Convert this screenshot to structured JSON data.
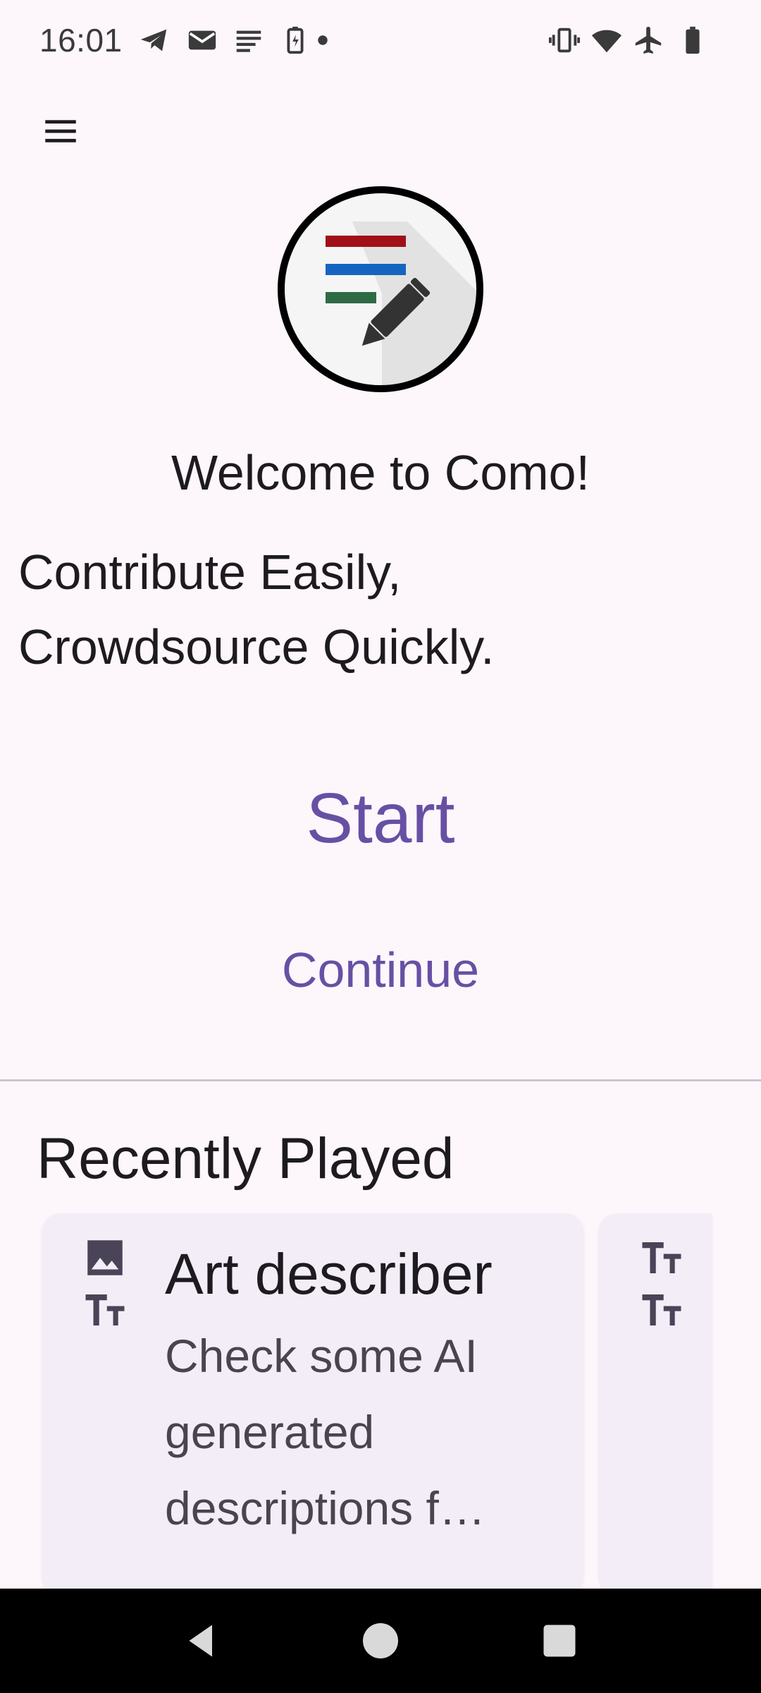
{
  "status_bar": {
    "time": "16:01",
    "left_icons": [
      "telegram-icon",
      "mail-icon",
      "notes-icon",
      "battery-saver-icon",
      "dot-icon"
    ],
    "right_icons": [
      "vibrate-icon",
      "wifi-icon",
      "airplane-mode-icon",
      "battery-icon"
    ]
  },
  "app_bar": {
    "menu_icon": "menu-icon"
  },
  "hero": {
    "logo_icon": "como-logo",
    "welcome": "Welcome to Como!",
    "tagline_line1": "Contribute Easily,",
    "tagline_line2": "Crowdsource Quickly."
  },
  "actions": {
    "start_label": "Start",
    "continue_label": "Continue"
  },
  "recently_played": {
    "title": "Recently Played",
    "cards": [
      {
        "icons": [
          "image-icon",
          "text-fields-icon"
        ],
        "title": "Art describer",
        "description": "Check some AI generated descriptions f…"
      },
      {
        "icons": [
          "text-fields-icon",
          "text-fields-icon"
        ],
        "title": "",
        "description": ""
      }
    ]
  },
  "nav_bar": {
    "icons": [
      "back-icon",
      "home-icon",
      "recents-icon"
    ]
  },
  "colors": {
    "background": "#fdf7fc",
    "primary": "#6750a4",
    "card": "#f3edf7",
    "logo_red": "#a01016",
    "logo_blue": "#1565c0",
    "logo_green": "#2e6b44"
  }
}
